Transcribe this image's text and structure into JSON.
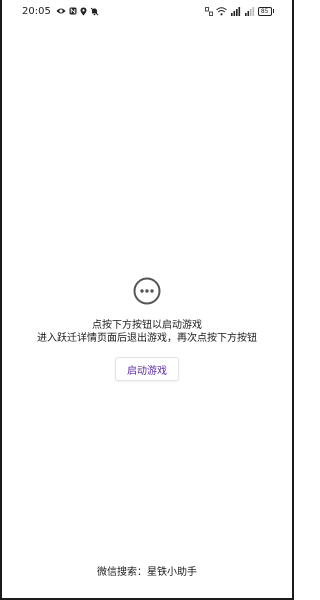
{
  "status_bar": {
    "time": "20:05",
    "left_icons": [
      "eye-icon",
      "nfc-icon",
      "location-icon",
      "bell-off-icon"
    ],
    "right_icons": [
      "data-speed-icon",
      "wifi-icon",
      "cell-signal-icon",
      "cell-signal-icon"
    ],
    "battery_level": "85"
  },
  "main": {
    "icon": "more-horizontal-circle-icon",
    "message_line1": "点按下方按钮以启动游戏",
    "message_line2": "进入跃迁详情页面后退出游戏，再次点按下方按钮",
    "launch_button_label": "启动游戏"
  },
  "footer": {
    "text": "微信搜索：星铁小助手"
  },
  "colors": {
    "accent": "#5b2ca0",
    "text": "#1a1a1a",
    "button_border": "#e3e3e3",
    "icon_gray": "#555555"
  }
}
